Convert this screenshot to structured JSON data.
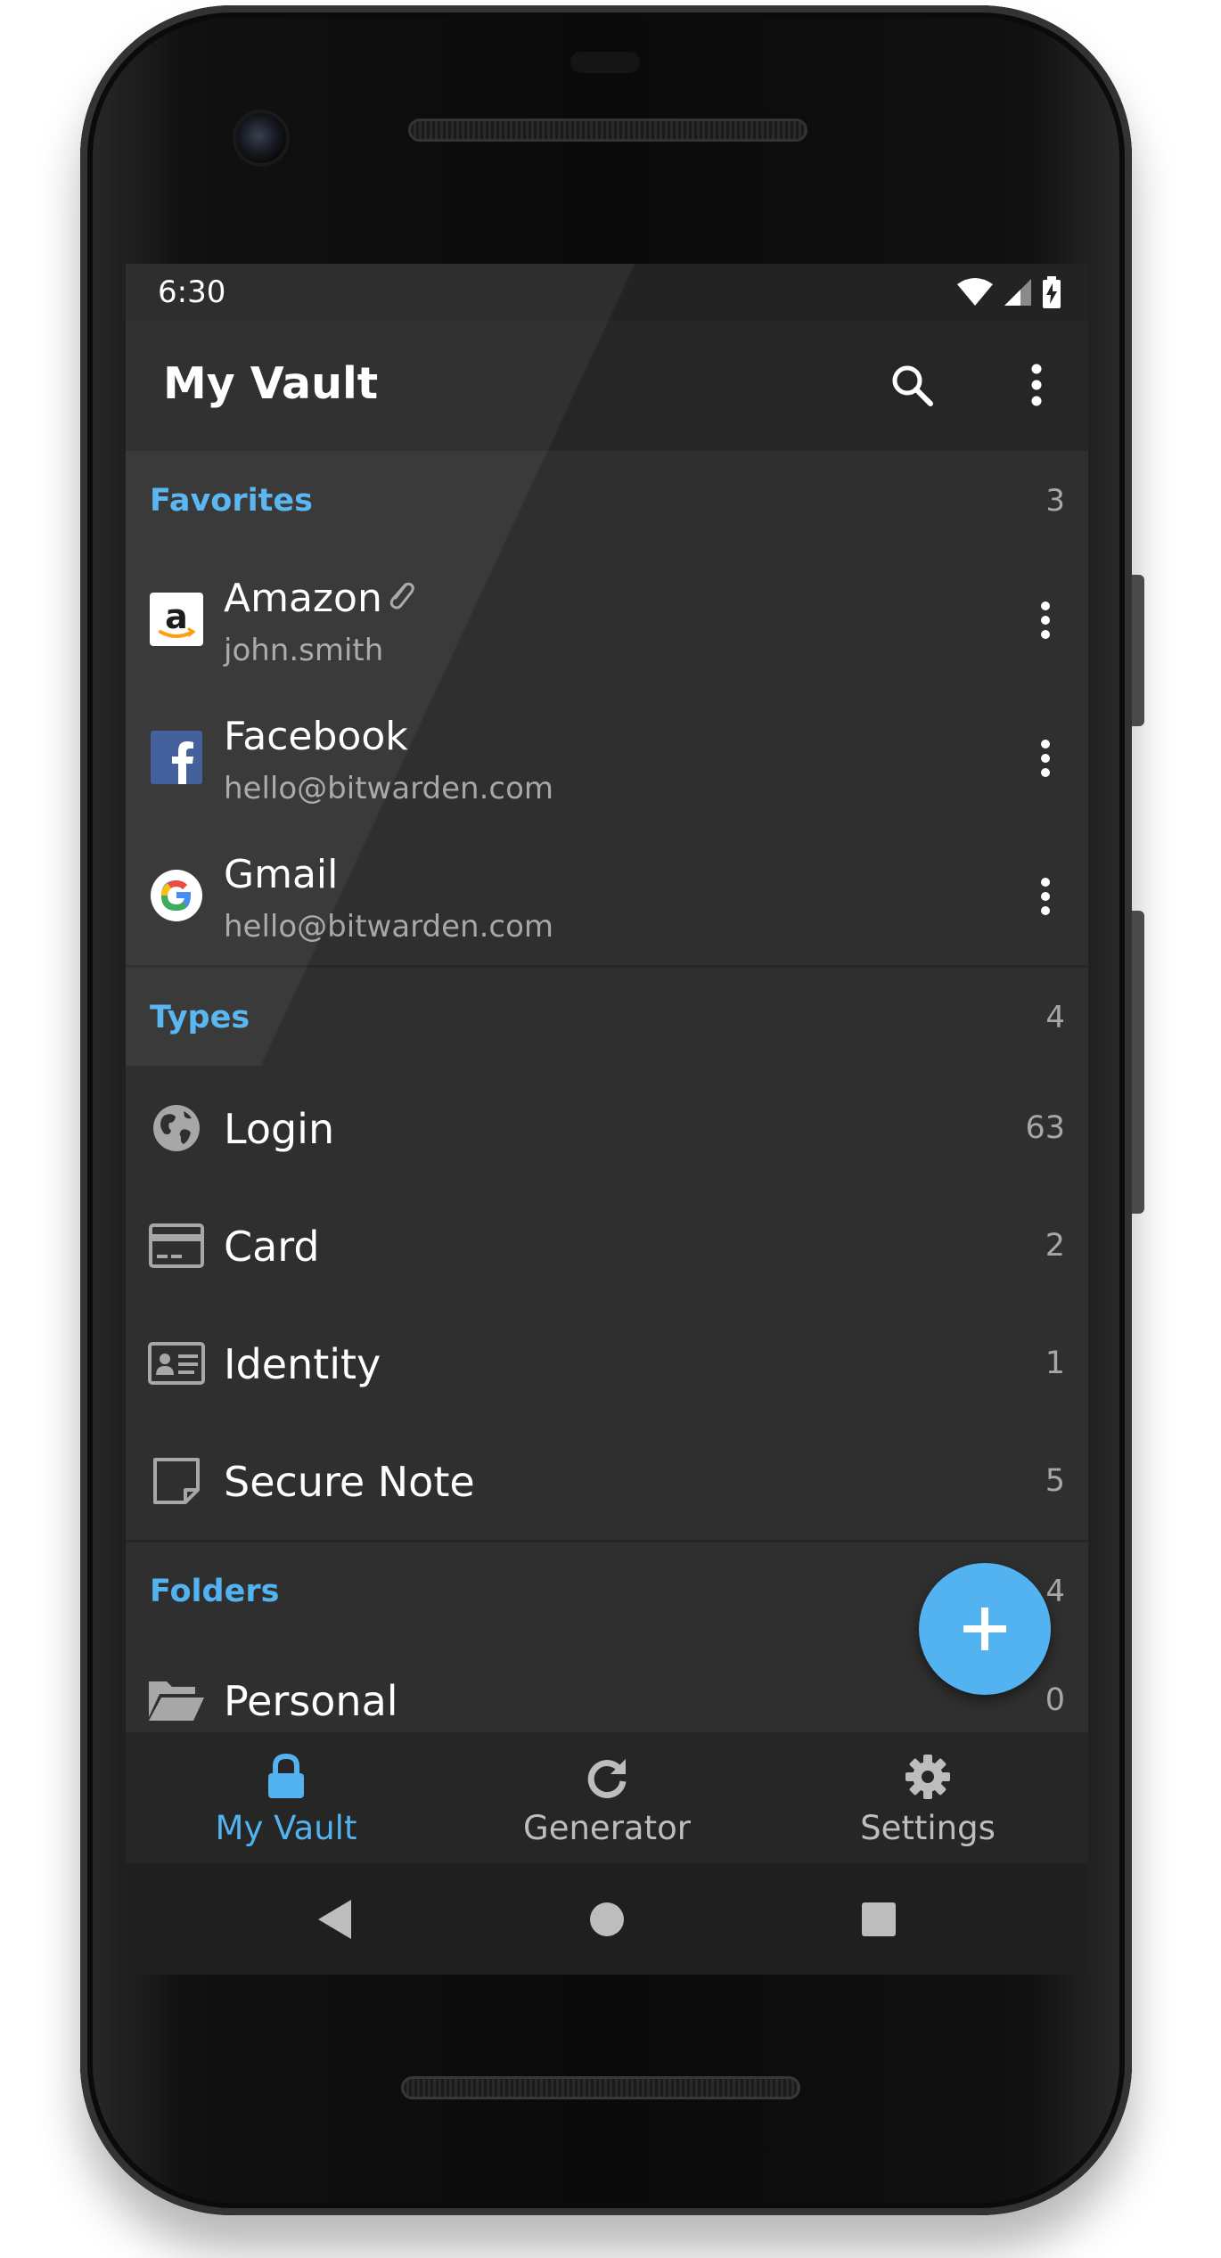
{
  "status_bar": {
    "time": "6:30"
  },
  "app_bar": {
    "title": "My Vault"
  },
  "favorites": {
    "title": "Favorites",
    "count": "3",
    "items": [
      {
        "name": "Amazon",
        "subtitle": "john.smith",
        "icon": "amazon-logo-icon",
        "has_attachment": true
      },
      {
        "name": "Facebook",
        "subtitle": "hello@bitwarden.com",
        "icon": "facebook-logo-icon",
        "has_attachment": false
      },
      {
        "name": "Gmail",
        "subtitle": "hello@bitwarden.com",
        "icon": "google-logo-icon",
        "has_attachment": false
      }
    ]
  },
  "types": {
    "title": "Types",
    "count": "4",
    "items": [
      {
        "name": "Login",
        "count": "63",
        "icon": "globe-icon"
      },
      {
        "name": "Card",
        "count": "2",
        "icon": "credit-card-icon"
      },
      {
        "name": "Identity",
        "count": "1",
        "icon": "id-card-icon"
      },
      {
        "name": "Secure Note",
        "count": "5",
        "icon": "note-icon"
      }
    ]
  },
  "folders": {
    "title": "Folders",
    "count": "4",
    "items": [
      {
        "name": "Personal",
        "count": "0",
        "icon": "folder-open-icon"
      }
    ]
  },
  "tabs": [
    {
      "label": "My Vault",
      "icon": "lock-icon",
      "active": true
    },
    {
      "label": "Generator",
      "icon": "refresh-icon",
      "active": false
    },
    {
      "label": "Settings",
      "icon": "gear-icon",
      "active": false
    }
  ],
  "colors": {
    "accent": "#52b3f0",
    "background": "#2f2f2f",
    "bar": "#262626",
    "text_primary": "#ffffff",
    "text_secondary": "#a7a7a7"
  }
}
